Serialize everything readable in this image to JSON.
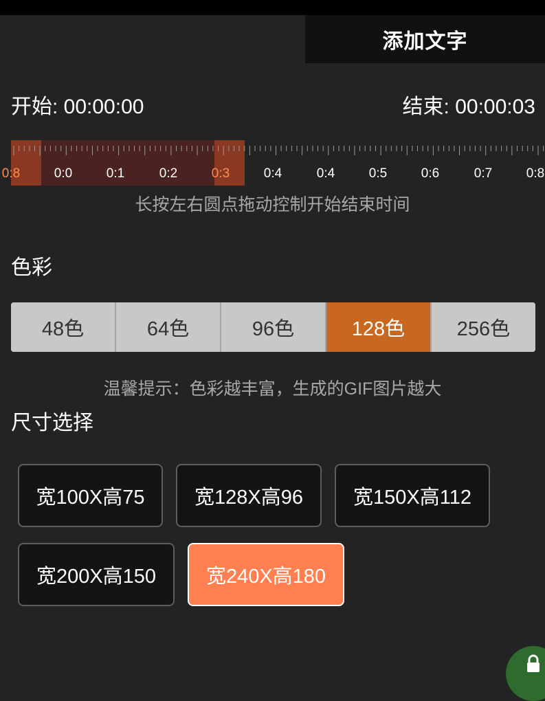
{
  "header": {
    "add_text_label": "添加文字"
  },
  "time": {
    "start_label": "开始: 00:00:00",
    "end_label": "结束: 00:00:03"
  },
  "timeline": {
    "tick_labels": [
      "0:8",
      "0:0",
      "0:1",
      "0:2",
      "0:3",
      "0:4",
      "0:4",
      "0:5",
      "0:6",
      "0:7",
      "0:8"
    ],
    "hint": "长按左右圆点拖动控制开始结束时间"
  },
  "color_section": {
    "title": "色彩",
    "options": [
      "48色",
      "64色",
      "96色",
      "128色",
      "256色"
    ],
    "selected": "128色",
    "hint": "温馨提示：色彩越丰富，生成的GIF图片越大",
    "accent_color": "#c8671f"
  },
  "size_section": {
    "title": "尺寸选择",
    "options": [
      "宽100X高75",
      "宽128X高96",
      "宽150X高112",
      "宽200X高150",
      "宽240X高180"
    ],
    "selected": "宽240X高180",
    "accent_color": "#ff7f50"
  },
  "fab": {
    "icon": "lock-icon"
  }
}
